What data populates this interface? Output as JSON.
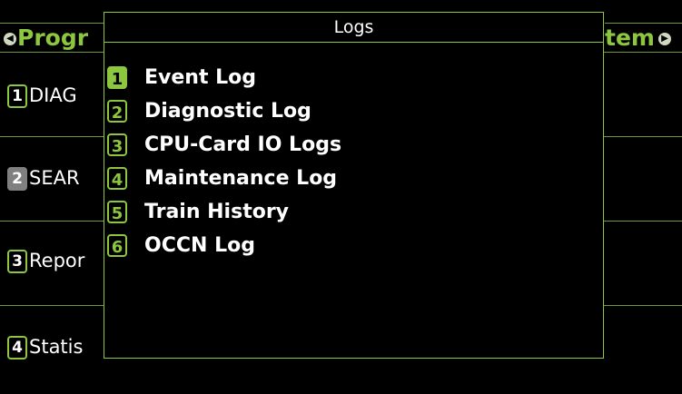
{
  "header": {
    "left_label": "Progr",
    "right_label": "tem"
  },
  "background_menu": [
    {
      "num": "1",
      "label": "DIAG"
    },
    {
      "num": "2",
      "label": "SEAR"
    },
    {
      "num": "3",
      "label": "Repor"
    },
    {
      "num": "4",
      "label": "Statis"
    }
  ],
  "dialog": {
    "title": "Logs",
    "items": [
      {
        "num": "1",
        "label": "Event Log"
      },
      {
        "num": "2",
        "label": "Diagnostic Log"
      },
      {
        "num": "3",
        "label": "CPU-Card IO Logs"
      },
      {
        "num": "4",
        "label": "Maintenance Log"
      },
      {
        "num": "5",
        "label": "Train History"
      },
      {
        "num": "6",
        "label": "OCCN Log"
      }
    ]
  },
  "colors": {
    "accent": "#8dc63f",
    "background": "#000000",
    "selected_background_item": "#808080"
  },
  "icons": {
    "left_arrow": "left-arrow-icon",
    "right_arrow": "right-arrow-icon"
  }
}
